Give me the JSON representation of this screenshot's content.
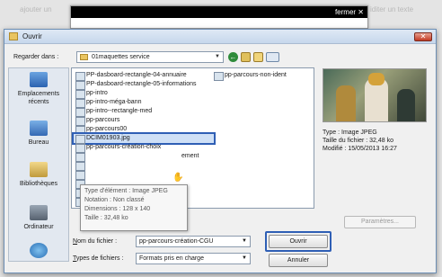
{
  "background": {
    "left_text": "ajouter un",
    "right_text": "iditer un texte"
  },
  "popup": {
    "close_label": "fermer",
    "close_symbol": "✕"
  },
  "dialog": {
    "title": "Ouvrir",
    "close_symbol": "✕",
    "look_in_label": "Regarder dans :",
    "look_in_value": "01maquettes service",
    "toolbar_icons": [
      "back-icon",
      "up-folder-icon",
      "new-folder-icon",
      "view-menu-icon"
    ],
    "places": [
      {
        "label": "Emplacements récents",
        "icon": "recent-places-icon"
      },
      {
        "label": "Bureau",
        "icon": "desktop-icon"
      },
      {
        "label": "Bibliothèques",
        "icon": "libraries-icon"
      },
      {
        "label": "Ordinateur",
        "icon": "computer-icon"
      },
      {
        "label": "",
        "icon": "network-icon"
      }
    ],
    "files_col1": [
      "PP-dasboard-rectangle-04-annuaire",
      "PP-dasboard-rectangle-05-informations",
      "pp-intro",
      "pp-intro-méga-bann",
      "pp-intro--rectangle-med",
      "pp-parcours",
      "pp-parcours00",
      "DCIM01903.jpg",
      "pp-parcours-création-choix",
      "",
      "",
      "",
      "",
      "pp-parcours-ident-max",
      "pp-parcours-ident-primo"
    ],
    "file_col1_extra": "ement",
    "files_col2": [
      "pp-parcours-non-ident"
    ],
    "tooltip": {
      "type": "Type d'élément : Image JPEG",
      "notation": "Notation : Non classé",
      "dimensions": "Dimensions : 128 x 140",
      "size": "Taille : 32,48 ko"
    },
    "preview_info": {
      "type": "Type : Image JPEG",
      "size": "Taille du fichier : 32,48 ko",
      "modified": "Modifié : 15/05/2013 16:27"
    },
    "params_button": "Paramètres...",
    "filename_label_prefix": "N",
    "filename_label_rest": "om du fichier :",
    "filename_value": "pp-parcours-création-CGU",
    "filetype_label_prefix": "T",
    "filetype_label_rest": "ypes de fichiers :",
    "filetype_value": "Formats pris en charge",
    "open_button": "Ouvrir",
    "cancel_button": "Annuler"
  }
}
